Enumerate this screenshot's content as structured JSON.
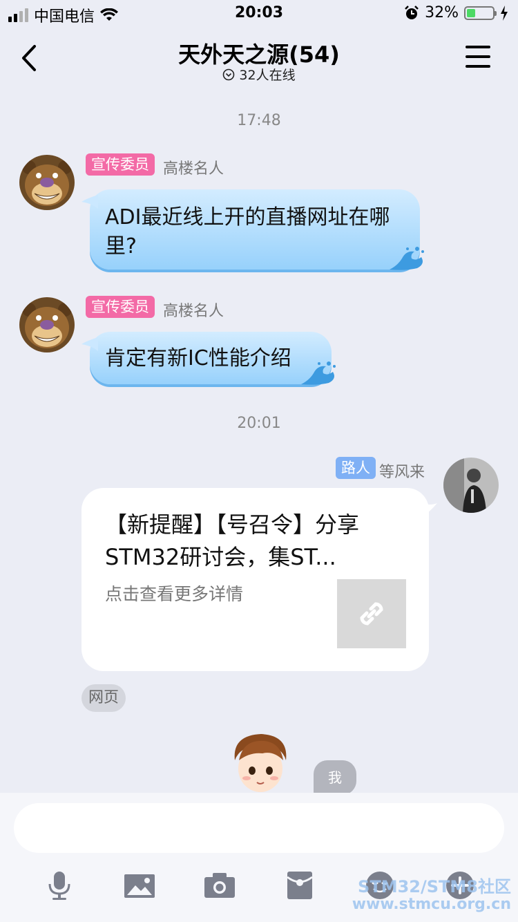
{
  "status_bar": {
    "carrier": "中国电信",
    "time": "20:03",
    "battery": "32%",
    "battery_level": 0.32
  },
  "header": {
    "title": "天外天之源(54)",
    "subtitle": "32人在线"
  },
  "messages": {
    "ts1": "17:48",
    "m1": {
      "badge": "宣传委员",
      "nick": "高楼名人",
      "text": "ADI最近线上开的直播网址在哪里?"
    },
    "m2": {
      "badge": "宣传委员",
      "nick": "高楼名人",
      "text": "肯定有新IC性能介绍"
    },
    "ts2": "20:01",
    "m3": {
      "badge": "路人",
      "nick": "等风来",
      "card_title": "【新提醒】【号召令】分享STM32研讨会，集ST...",
      "card_desc": "点击查看更多详情",
      "tag": "网页"
    },
    "me_chip": "我"
  },
  "input_bar": {
    "placeholder": ""
  },
  "toolbar": [
    "microphone-icon",
    "image-icon",
    "camera-icon",
    "red-packet-icon",
    "emoji-icon",
    "plus-icon"
  ],
  "watermark": {
    "line1": "STM32/STM8社区",
    "line2": "www.stmcu.org.cn"
  },
  "colors": {
    "bubble": "#b3dcfb",
    "badge_pink": "#f36aa6",
    "badge_blue": "#7fb0f5",
    "background": "#ebedf5"
  }
}
